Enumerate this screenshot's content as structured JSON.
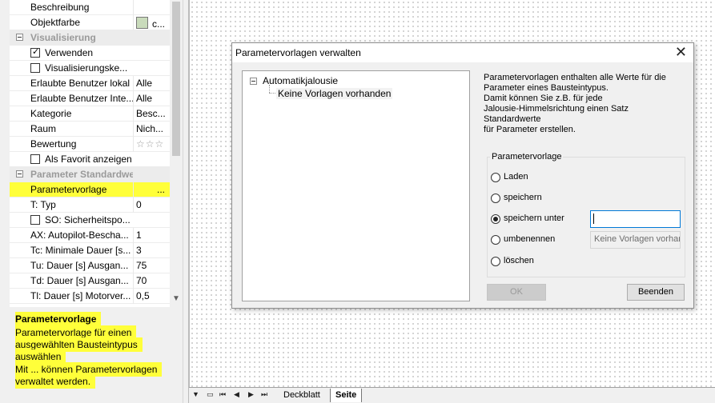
{
  "properties": {
    "rows": [
      {
        "kind": "prop",
        "name": "Beschreibung",
        "value": ""
      },
      {
        "kind": "prop",
        "name": "Objektfarbe",
        "value": "c..."
      },
      {
        "kind": "category",
        "name": "Visualisierung"
      },
      {
        "kind": "check",
        "name": "Verwenden",
        "checked": true
      },
      {
        "kind": "check",
        "name": "Visualisierungske...",
        "checked": false
      },
      {
        "kind": "prop",
        "name": "Erlaubte Benutzer lokal",
        "value": "Alle"
      },
      {
        "kind": "prop",
        "name": "Erlaubte Benutzer Inte...",
        "value": "Alle"
      },
      {
        "kind": "prop",
        "name": "Kategorie",
        "value": "Besc..."
      },
      {
        "kind": "prop",
        "name": "Raum",
        "value": "Nich..."
      },
      {
        "kind": "prop",
        "name": "Bewertung",
        "value": "☆☆☆"
      },
      {
        "kind": "check",
        "name": "Als Favorit anzeigen",
        "checked": false
      },
      {
        "kind": "category",
        "name": "Parameter Standardwert"
      },
      {
        "kind": "prop",
        "name": "Parametervorlage",
        "value": "...",
        "highlight": true
      },
      {
        "kind": "prop",
        "name": "T: Typ",
        "value": "0"
      },
      {
        "kind": "check",
        "name": "SO: Sicherheitspo...",
        "checked": false
      },
      {
        "kind": "prop",
        "name": "AX: Autopilot-Bescha...",
        "value": "1"
      },
      {
        "kind": "prop",
        "name": "Tc: Minimale Dauer [s...",
        "value": "3"
      },
      {
        "kind": "prop",
        "name": "Tu: Dauer [s] Ausgan...",
        "value": "75"
      },
      {
        "kind": "prop",
        "name": "Td: Dauer [s] Ausgan...",
        "value": "70"
      },
      {
        "kind": "prop",
        "name": "Tl: Dauer [s] Motorver...",
        "value": "0,5"
      }
    ],
    "swatch_color": "#c9dbbb"
  },
  "description": {
    "title": "Parametervorlage",
    "lines": [
      "Parametervorlage für einen",
      "ausgewählten Bausteintypus",
      "auswählen",
      "Mit ... können Parametervorlagen",
      "verwaltet werden."
    ]
  },
  "tabs": {
    "items": [
      "Deckblatt",
      "Seite"
    ],
    "active": "Seite"
  },
  "dialog": {
    "title": "Parametervorlagen verwalten",
    "close_glyph": "✕",
    "tree": {
      "root": "Automatikjalousie",
      "child": "Keine Vorlagen vorhanden"
    },
    "info_lines": [
      "Parametervorlagen enthalten alle Werte für die",
      "Parameter eines Bausteintypus.",
      "Damit können Sie z.B. für jede",
      "Jalousie-Himmelsrichtung einen Satz Standardwerte",
      "für Parameter erstellen."
    ],
    "group_label": "Parametervorlage",
    "options": [
      {
        "label": "Laden",
        "selected": false
      },
      {
        "label": "speichern",
        "selected": false
      },
      {
        "label": "speichern unter",
        "selected": true
      },
      {
        "label": "umbenennen",
        "selected": false
      },
      {
        "label": "löschen",
        "selected": false
      }
    ],
    "name_input_value": "",
    "rename_placeholder": "Keine Vorlagen vorhar",
    "ok_label": "OK",
    "close_label": "Beenden"
  },
  "colors": {
    "highlight": "#ffff3a",
    "focus_border": "#0078d7"
  }
}
